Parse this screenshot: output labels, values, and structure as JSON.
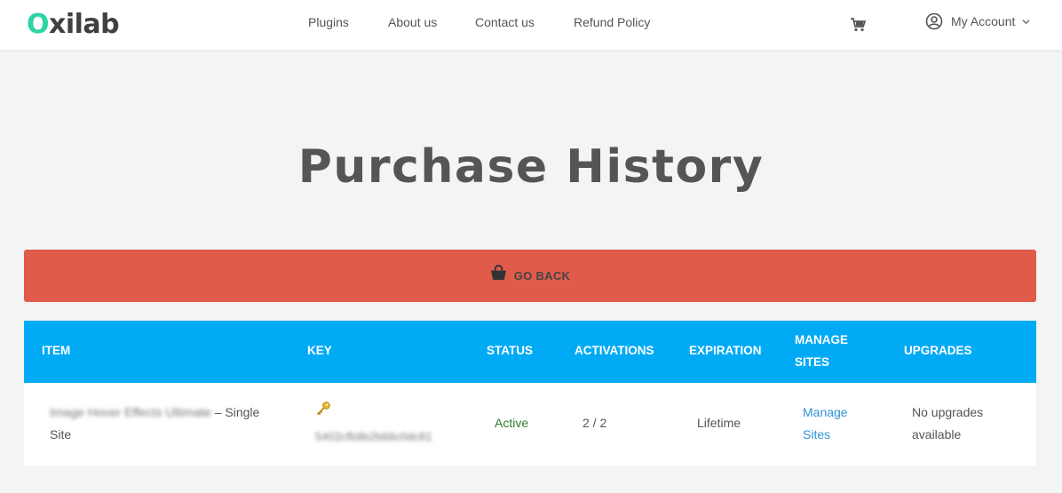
{
  "header": {
    "logo_first": "O",
    "logo_rest": "xilab",
    "nav": [
      "Plugins",
      "About us",
      "Contact us",
      "Refund Policy"
    ],
    "account_label": "My Account"
  },
  "page": {
    "title": "Purchase History"
  },
  "back_button": {
    "label": "GO BACK"
  },
  "table": {
    "headers": {
      "item": "ITEM",
      "key": "KEY",
      "status": "STATUS",
      "activations": "ACTIVATIONS",
      "expiration": "EXPIRATION",
      "manage_sites_1": "MANAGE",
      "manage_sites_2": "SITES",
      "upgrades": "UPGRADES"
    },
    "row": {
      "item_name": "Image Hover Effects Ultimate",
      "item_suffix": "– Single",
      "item_suffix2": "Site",
      "key": "5402cfb9b2b66c0dc81",
      "status": "Active",
      "activations": "2 / 2",
      "expiration": "Lifetime",
      "manage_1": "Manage",
      "manage_2": "Sites",
      "upgrades_1": "No upgrades",
      "upgrades_2": "available"
    }
  },
  "colors": {
    "brand_accent": "#2bd3a5",
    "back_button": "#e05b4a",
    "table_header": "#00aaf5",
    "status_active": "#2e7d32",
    "link": "#2e93d6"
  },
  "icons": [
    "cart-icon",
    "user-circle-icon",
    "chevron-down-icon",
    "shopping-bag-icon",
    "key-icon"
  ]
}
